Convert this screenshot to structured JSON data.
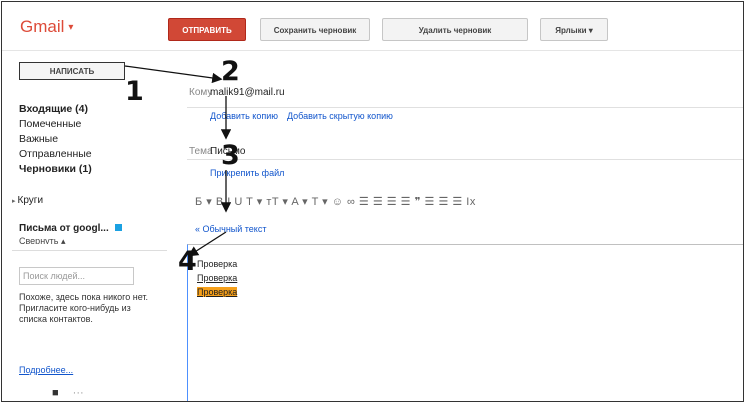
{
  "header": {
    "logo": "Gmail",
    "logo_caret": "▾",
    "send_label": "ОТПРАВИТЬ",
    "save_draft_label": "Сохранить черновик",
    "delete_draft_label": "Удалить черновик",
    "labels_label": "Ярлыки ▾"
  },
  "sidebar": {
    "compose_label": "НАПИСАТЬ",
    "items": [
      {
        "label": "Входящие (4)"
      },
      {
        "label": "Помеченные"
      },
      {
        "label": "Важные"
      },
      {
        "label": "Отправленные"
      },
      {
        "label": "Черновики (1)"
      }
    ],
    "circles_label": "Круги",
    "hangout_label": "Письма от googl...",
    "hangout_sub": "Свернуть ▴",
    "people_search_placeholder": "Поиск людей...",
    "no_contacts_text": "Похоже, здесь пока никого нет. Пригласите кого-нибудь из списка контактов.",
    "more_link": "Подробнее..."
  },
  "compose": {
    "to_label": "Кому",
    "to_value": "malik91@mail.ru",
    "add_cc": "Добавить копию",
    "add_bcc": "Добавить скрытую копию",
    "subject_label": "Тема",
    "subject_value": "Письмо",
    "attach_label": "Прикрепить файл",
    "toolbar_text": "Б ▾ B I U T ▾ ᴛT ▾ A ▾ T ▾ ☺ ∞ ☰ ☰ ☰ ☰ ❞ ☰ ☰ ☰ Ix",
    "plain_text_link": "« Обычный текст",
    "body_lines": [
      "Проверка",
      "Проверка",
      "Проверка"
    ]
  },
  "annotations": {
    "step_1": "1",
    "step_2": "2",
    "step_3": "3",
    "step_4": "4"
  },
  "colors": {
    "brand_red": "#dd4b39",
    "send_red": "#d14836",
    "link_blue": "#1155cc",
    "highlight_orange": "#f6a01a"
  }
}
